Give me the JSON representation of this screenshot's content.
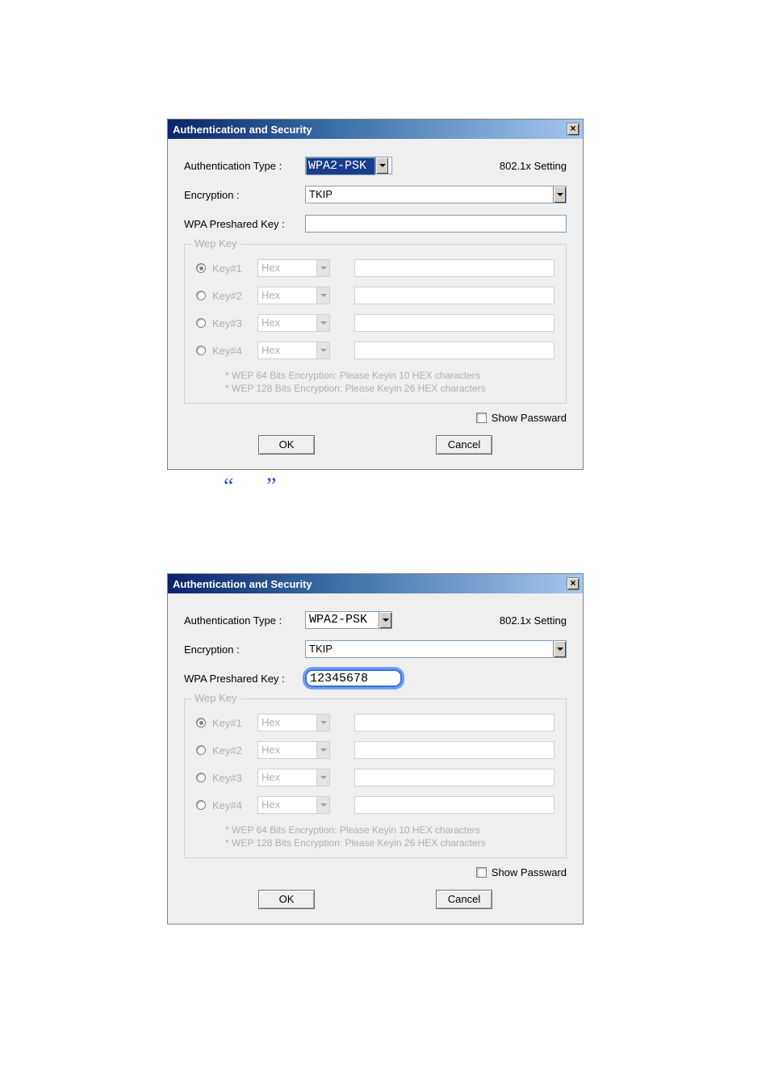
{
  "dialog1": {
    "title": "Authentication and Security",
    "authTypeLabel": "Authentication Type :",
    "authTypeValue": "WPA2-PSK",
    "btn8021x": "802.1x Setting",
    "encryptionLabel": "Encryption :",
    "encryptionValue": "TKIP",
    "wpaKeyLabel": "WPA Preshared Key :",
    "wpaKeyValue": "",
    "wepGroup": "Wep Key",
    "keys": [
      {
        "name": "Key#1",
        "fmt": "Hex",
        "checked": true
      },
      {
        "name": "Key#2",
        "fmt": "Hex",
        "checked": false
      },
      {
        "name": "Key#3",
        "fmt": "Hex",
        "checked": false
      },
      {
        "name": "Key#4",
        "fmt": "Hex",
        "checked": false
      }
    ],
    "hint1": "* WEP 64 Bits Encryption:   Please Keyin 10 HEX characters",
    "hint2": "* WEP 128 Bits Encryption:   Please Keyin 26 HEX characters",
    "showPw": "Show Passward",
    "ok": "OK",
    "cancel": "Cancel"
  },
  "dialog2": {
    "title": "Authentication and Security",
    "authTypeLabel": "Authentication Type :",
    "authTypeValue": "WPA2-PSK",
    "btn8021x": "802.1x Setting",
    "encryptionLabel": "Encryption :",
    "encryptionValue": "TKIP",
    "wpaKeyLabel": "WPA Preshared Key :",
    "wpaKeyValue": "12345678",
    "wepGroup": "Wep Key",
    "keys": [
      {
        "name": "Key#1",
        "fmt": "Hex",
        "checked": true
      },
      {
        "name": "Key#2",
        "fmt": "Hex",
        "checked": false
      },
      {
        "name": "Key#3",
        "fmt": "Hex",
        "checked": false
      },
      {
        "name": "Key#4",
        "fmt": "Hex",
        "checked": false
      }
    ],
    "hint1": "* WEP 64 Bits Encryption:   Please Keyin 10 HEX characters",
    "hint2": "* WEP 128 Bits Encryption:   Please Keyin 26 HEX characters",
    "showPw": "Show Passward",
    "ok": "OK",
    "cancel": "Cancel"
  }
}
